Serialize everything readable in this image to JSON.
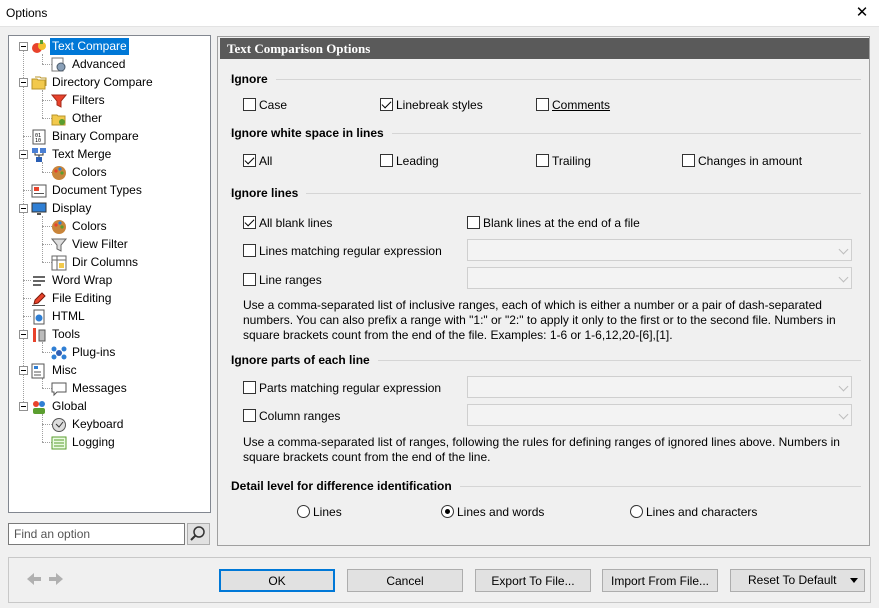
{
  "window": {
    "title": "Options"
  },
  "tree": {
    "items": [
      {
        "label": "Text Compare"
      },
      {
        "label": "Advanced"
      },
      {
        "label": "Directory Compare"
      },
      {
        "label": "Filters"
      },
      {
        "label": "Other"
      },
      {
        "label": "Binary Compare"
      },
      {
        "label": "Text Merge"
      },
      {
        "label": "Colors"
      },
      {
        "label": "Document Types"
      },
      {
        "label": "Display"
      },
      {
        "label": "Colors"
      },
      {
        "label": "View Filter"
      },
      {
        "label": "Dir Columns"
      },
      {
        "label": "Word Wrap"
      },
      {
        "label": "File Editing"
      },
      {
        "label": "HTML"
      },
      {
        "label": "Tools"
      },
      {
        "label": "Plug-ins"
      },
      {
        "label": "Misc"
      },
      {
        "label": "Messages"
      },
      {
        "label": "Global"
      },
      {
        "label": "Keyboard"
      },
      {
        "label": "Logging"
      }
    ]
  },
  "search": {
    "placeholder": "Find an option"
  },
  "panel": {
    "header": "Text Comparison Options",
    "ignore": {
      "title": "Ignore",
      "case": "Case",
      "linebreak": "Linebreak styles",
      "comments": "Comments"
    },
    "whitespace": {
      "title": "Ignore white space in lines",
      "all": "All",
      "leading": "Leading",
      "trailing": "Trailing",
      "changes": "Changes in amount"
    },
    "lines": {
      "title": "Ignore lines",
      "blank": "All blank lines",
      "blank_end": "Blank lines at the end of a file",
      "regex": "Lines matching regular expression",
      "ranges": "Line ranges",
      "note1": "Use a comma-separated list of inclusive ranges, each of which is either a number or a pair of dash-separated",
      "note2": "numbers. You can also prefix a range with \"1:\" or \"2:\" to apply it only to the first or to the second file. Numbers in",
      "note3": "square brackets count from the end of the file. Examples: 1-6 or 1-6,12,20-[6],[1]."
    },
    "parts": {
      "title": "Ignore parts of each line",
      "regex": "Parts matching regular expression",
      "columns": "Column ranges",
      "note1": "Use a comma-separated list of ranges, following the rules for defining ranges of ignored lines above. Numbers in",
      "note2": "square brackets count from the end of the line."
    },
    "detail": {
      "title": "Detail level for difference identification",
      "lines": "Lines",
      "words": "Lines and words",
      "chars": "Lines and characters"
    }
  },
  "buttons": {
    "ok": "OK",
    "cancel": "Cancel",
    "export": "Export To File...",
    "import": "Import From File...",
    "reset": "Reset To Default"
  }
}
